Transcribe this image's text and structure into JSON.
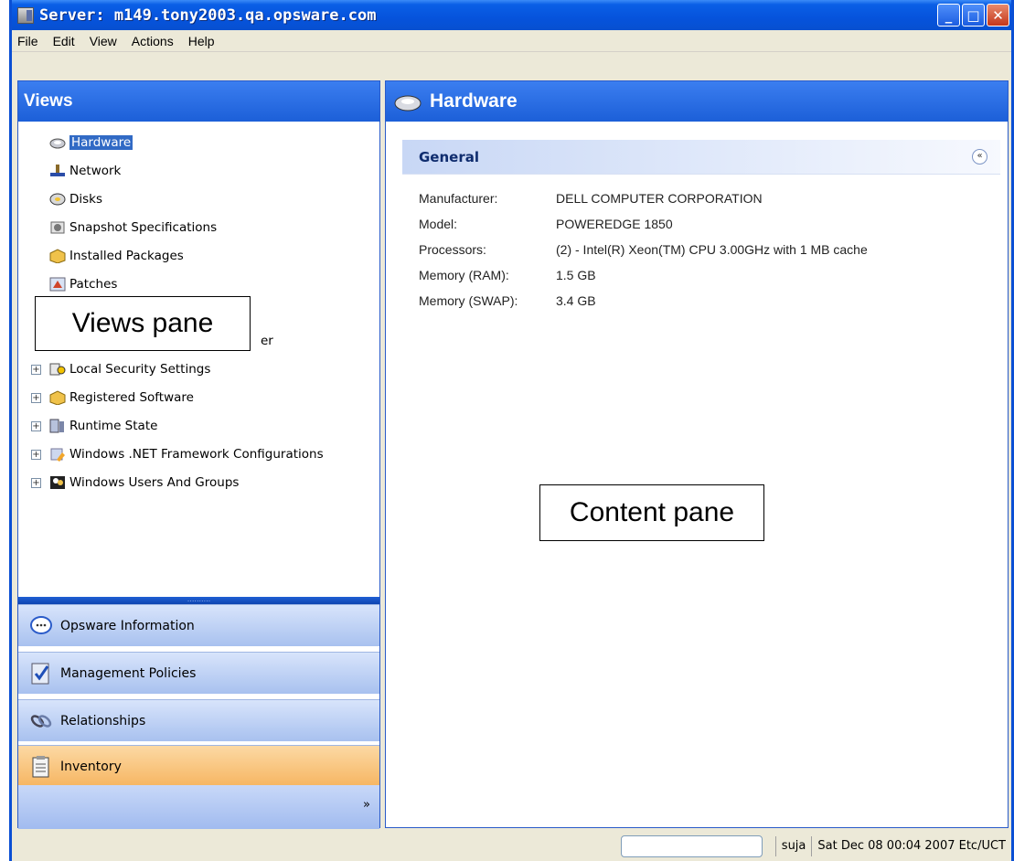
{
  "window": {
    "title": "Server: m149.tony2003.qa.opsware.com"
  },
  "menu": [
    "File",
    "Edit",
    "View",
    "Actions",
    "Help"
  ],
  "views": {
    "header": "Views",
    "tree": [
      {
        "label": "Hardware",
        "icon": "hardware-icon",
        "selected": true
      },
      {
        "label": "Network",
        "icon": "network-icon"
      },
      {
        "label": "Disks",
        "icon": "disk-icon"
      },
      {
        "label": "Snapshot Specifications",
        "icon": "snapshot-icon"
      },
      {
        "label": "Installed Packages",
        "icon": "package-icon"
      },
      {
        "label": "Patches",
        "icon": "patch-icon"
      },
      {
        "label": "er",
        "icon": ""
      },
      {
        "label": "Local Security Settings",
        "icon": "security-icon",
        "expandable": true
      },
      {
        "label": "Registered Software",
        "icon": "package-icon",
        "expandable": true
      },
      {
        "label": "Runtime State",
        "icon": "server-icon",
        "expandable": true
      },
      {
        "label": "Windows .NET Framework Configurations",
        "icon": "dotnet-icon",
        "expandable": true
      },
      {
        "label": "Windows Users And Groups",
        "icon": "users-icon",
        "expandable": true
      }
    ],
    "splitter": "..........",
    "bar_buttons": [
      {
        "label": "Opsware Information",
        "icon": "speech-bubble-icon"
      },
      {
        "label": "Management Policies",
        "icon": "policy-icon"
      },
      {
        "label": "Relationships",
        "icon": "link-icon"
      },
      {
        "label": "Inventory",
        "icon": "clipboard-icon",
        "active": true
      }
    ],
    "more": "»"
  },
  "content": {
    "header": "Hardware",
    "section": "General",
    "collapse": "«",
    "properties": [
      {
        "label": "Manufacturer:",
        "value": "DELL COMPUTER CORPORATION"
      },
      {
        "label": "Model:",
        "value": "POWEREDGE 1850"
      },
      {
        "label": "Processors:",
        "value": "(2) - Intel(R) Xeon(TM) CPU 3.00GHz with 1 MB cache"
      },
      {
        "label": "Memory (RAM):",
        "value": "1.5 GB"
      },
      {
        "label": "Memory (SWAP):",
        "value": "3.4 GB"
      }
    ]
  },
  "annotations": {
    "views_pane": "Views pane",
    "content_pane": "Content pane"
  },
  "status": {
    "user": "suja",
    "datetime": "Sat Dec 08 00:04 2007 Etc/UCT"
  },
  "colors": {
    "title_blue": "#0653dc",
    "selection": "#316ac5",
    "active_bar": "#f6b561"
  }
}
